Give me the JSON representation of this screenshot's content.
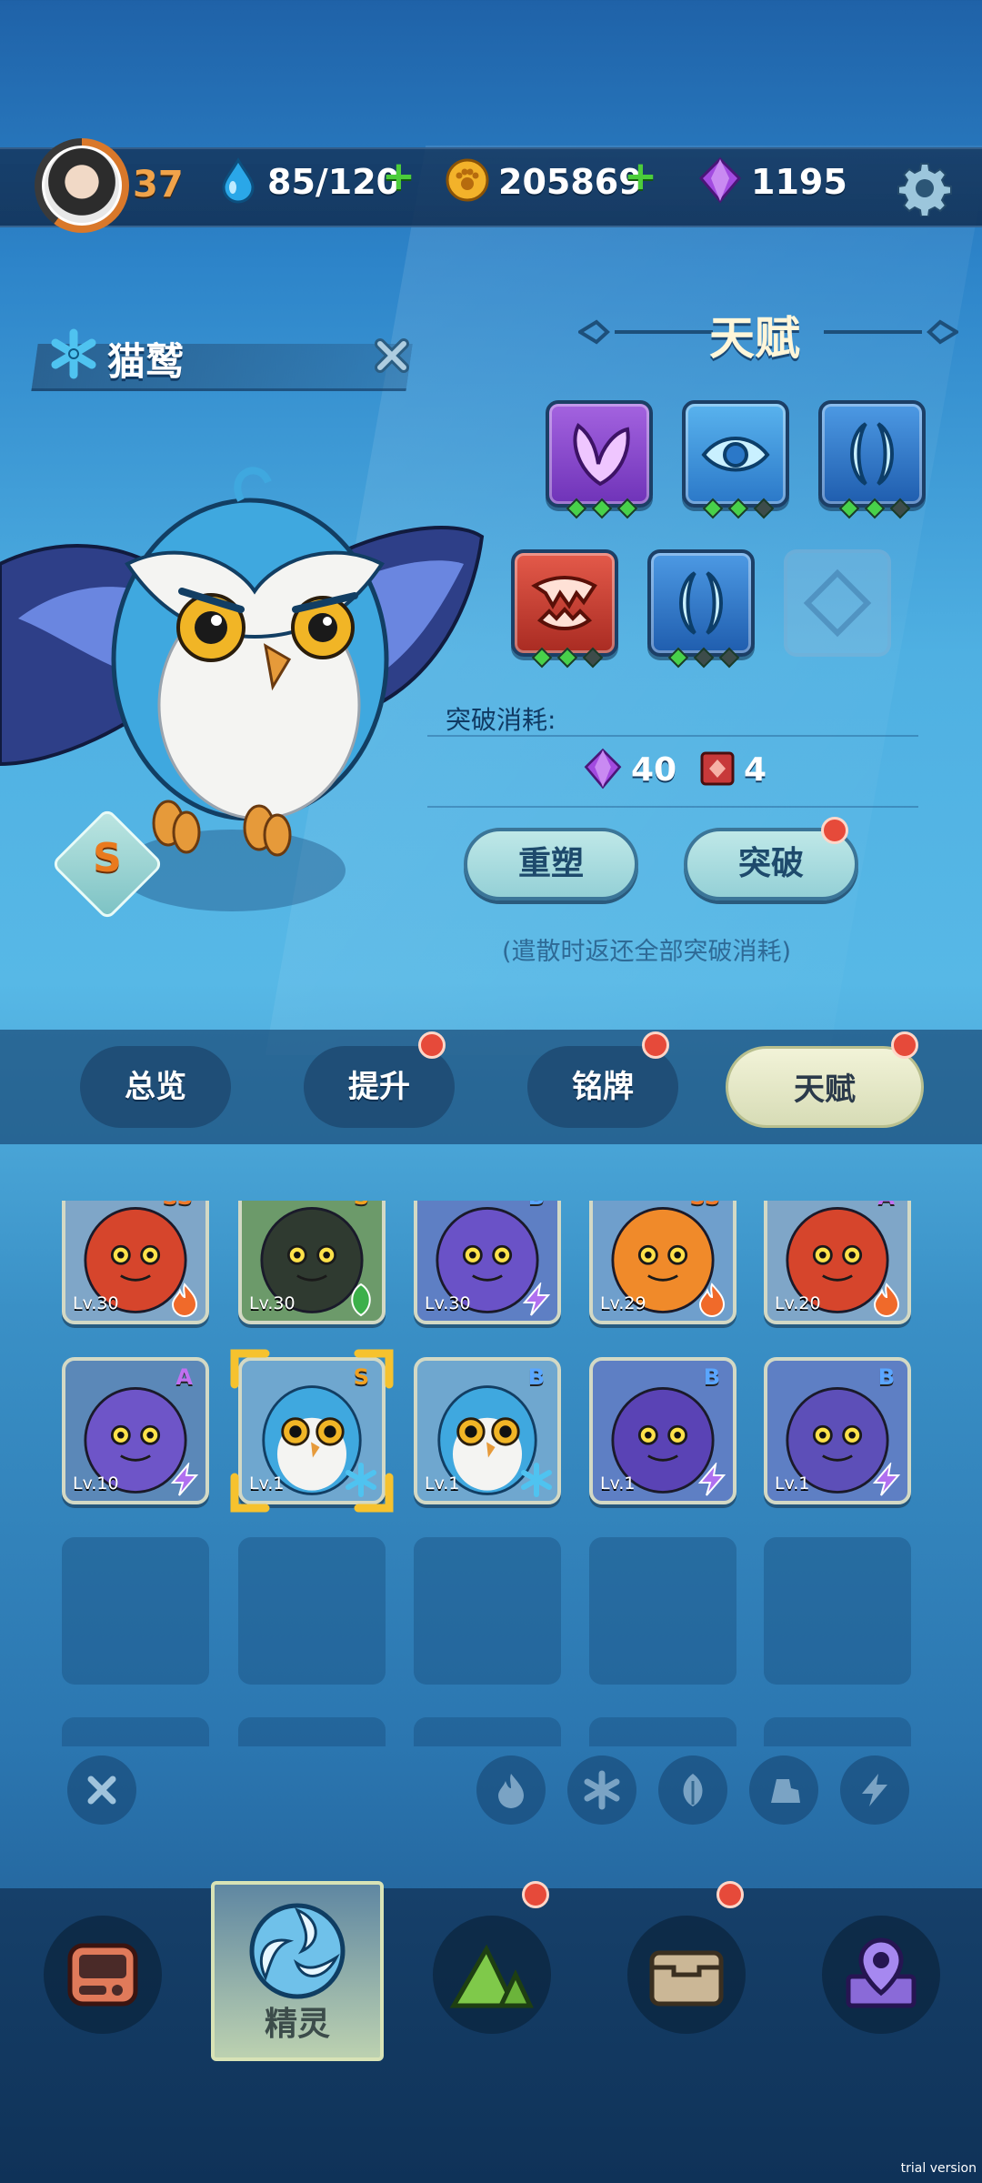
{
  "header": {
    "player_level": "37",
    "stamina": "85/120",
    "coins": "205869",
    "gems": "1195"
  },
  "creature": {
    "name": "猫鹫",
    "rank": "S"
  },
  "talent": {
    "title": "天赋",
    "skills": [
      {
        "icon": "wing-icon",
        "color": "#8e4ccf",
        "gems_on": 3,
        "gems_total": 3
      },
      {
        "icon": "eye-icon",
        "color": "#3a8fd4",
        "gems_on": 2,
        "gems_total": 3
      },
      {
        "icon": "crescent-icon",
        "color": "#2a6fc0",
        "gems_on": 2,
        "gems_total": 3
      },
      {
        "icon": "fang-icon",
        "color": "#c0392b",
        "gems_on": 2,
        "gems_total": 3
      },
      {
        "icon": "crescent-icon",
        "color": "#2a6fc0",
        "gems_on": 1,
        "gems_total": 3
      },
      {
        "icon": "locked-slot-icon",
        "color": "#8fbcd8",
        "gems_on": 0,
        "gems_total": 0
      }
    ],
    "break_cost_label": "突破消耗:",
    "cost_gems": "40",
    "cost_books": "4",
    "reshape_label": "重塑",
    "break_label": "突破",
    "refund_note": "(遣散时返还全部突破消耗)"
  },
  "tabs": [
    {
      "label": "总览",
      "badge": false
    },
    {
      "label": "提升",
      "badge": true
    },
    {
      "label": "铭牌",
      "badge": true
    },
    {
      "label": "天赋",
      "badge": true,
      "active": true
    }
  ],
  "creatures": [
    {
      "name": "red-dragon",
      "level": "Lv.30",
      "rank": "SS",
      "element": "fire-icon",
      "bg": "#7fa6c8",
      "color": "#d6452c"
    },
    {
      "name": "hooded-shadow",
      "level": "Lv.30",
      "rank": "S",
      "element": "leaf-icon",
      "bg": "#6c9a6a",
      "color": "#2f3a30"
    },
    {
      "name": "purple-cat",
      "level": "Lv.30",
      "rank": "B",
      "element": "lightning-icon",
      "bg": "#5e7fc4",
      "color": "#6a52c7"
    },
    {
      "name": "fire-imp",
      "level": "Lv.29",
      "rank": "SS",
      "element": "fire-icon",
      "bg": "#6f9fcc",
      "color": "#f08a2a"
    },
    {
      "name": "red-dragon",
      "level": "Lv.20",
      "rank": "A",
      "element": "fire-icon",
      "bg": "#7fa6c8",
      "color": "#d6452c"
    },
    {
      "name": "purple-croc",
      "level": "Lv.10",
      "rank": "A",
      "element": "lightning-icon",
      "bg": "#5b88b8",
      "color": "#6e55c8"
    },
    {
      "name": "owl",
      "level": "Lv.1",
      "rank": "S",
      "element": "snowflake-icon",
      "bg": "#6fa7cf",
      "color": "#ffffff",
      "selected": true
    },
    {
      "name": "owl",
      "level": "Lv.1",
      "rank": "B",
      "element": "snowflake-icon",
      "bg": "#6fa7cf",
      "color": "#ffffff"
    },
    {
      "name": "purple-bat",
      "level": "Lv.1",
      "rank": "B",
      "element": "lightning-icon",
      "bg": "#5e7fc4",
      "color": "#5a43b5"
    },
    {
      "name": "purple-mouse",
      "level": "Lv.1",
      "rank": "B",
      "element": "lightning-icon",
      "bg": "#5e7fc4",
      "color": "#5d4fb8"
    }
  ],
  "rank_colors": {
    "SS": "#f07a2a",
    "S": "#f0a020",
    "A": "#c070f0",
    "B": "#5aa6ff"
  },
  "filters": [
    "close-icon",
    "fire-icon",
    "snowflake-icon",
    "leaf-icon",
    "rock-icon",
    "lightning-icon"
  ],
  "nav": [
    {
      "icon": "backpack-device-icon",
      "badge": false
    },
    {
      "icon": "spirit-swirl-icon",
      "label": "精灵",
      "active": true
    },
    {
      "icon": "mountain-icon",
      "badge": true
    },
    {
      "icon": "chest-icon",
      "badge": true
    },
    {
      "icon": "map-pin-icon",
      "badge": false
    }
  ],
  "watermark": "trial version"
}
